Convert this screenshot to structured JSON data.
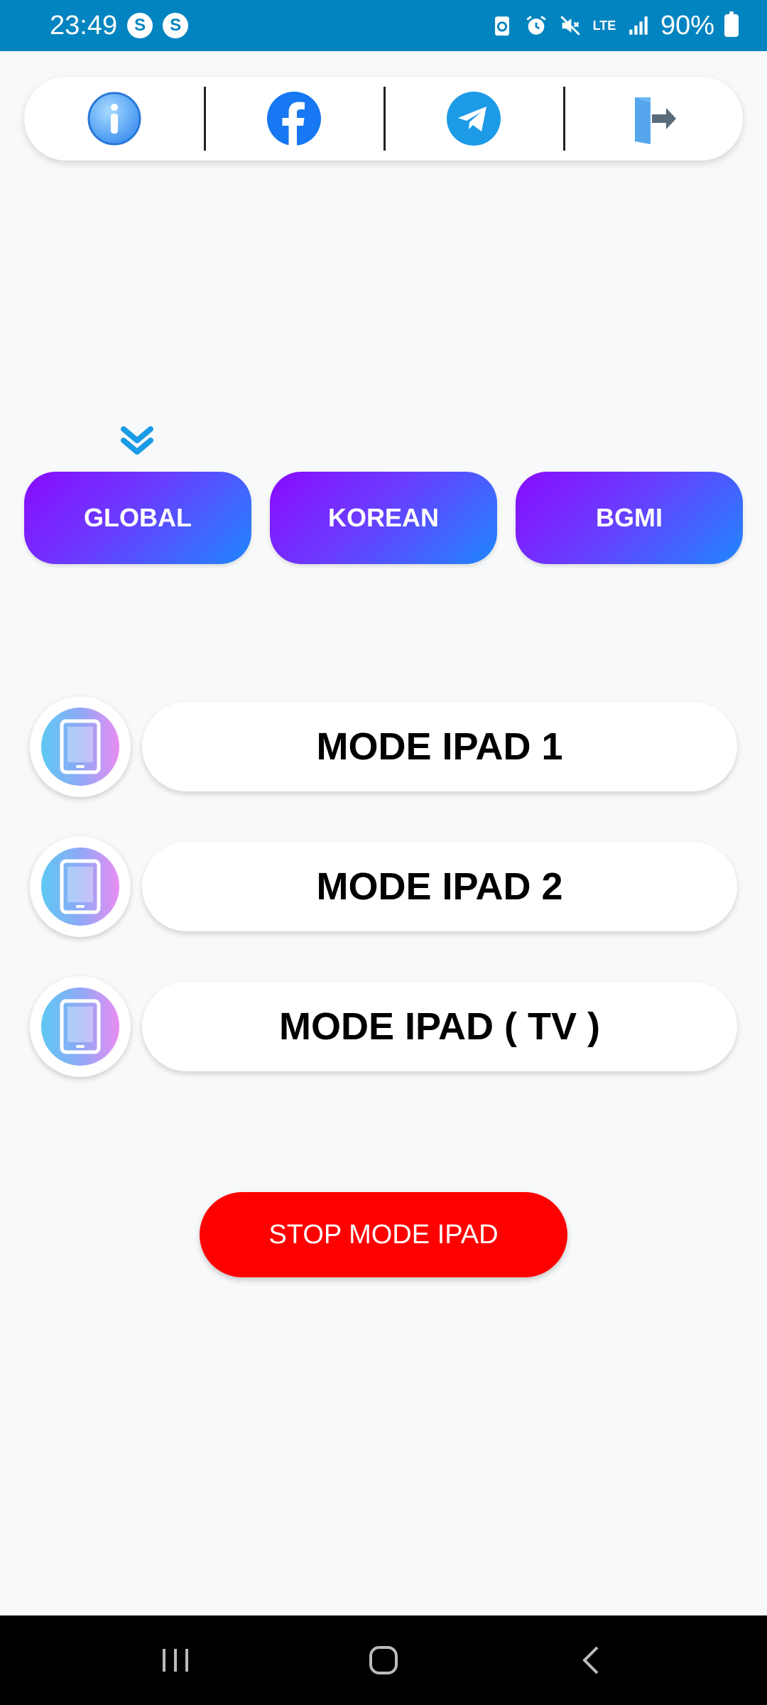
{
  "status_bar": {
    "time": "23:49",
    "badge_letter": "S",
    "lte_label": "LTE",
    "battery_text": "90%"
  },
  "toolbar": {
    "items": [
      {
        "icon": "info-icon"
      },
      {
        "icon": "facebook-icon"
      },
      {
        "icon": "telegram-icon"
      },
      {
        "icon": "exit-icon"
      }
    ]
  },
  "regions": [
    {
      "label": "GLOBAL"
    },
    {
      "label": "KOREAN"
    },
    {
      "label": "BGMI"
    }
  ],
  "modes": [
    {
      "label": "MODE IPAD 1"
    },
    {
      "label": "MODE IPAD 2"
    },
    {
      "label": "MODE IPAD ( TV )"
    }
  ],
  "stop_button": {
    "label": "STOP MODE IPAD"
  },
  "colors": {
    "status_bar": "#0284c0",
    "region_gradient_start": "#8a0bff",
    "region_gradient_end": "#1f87ff",
    "stop": "#ff0000",
    "chevron": "#1a9be6"
  }
}
